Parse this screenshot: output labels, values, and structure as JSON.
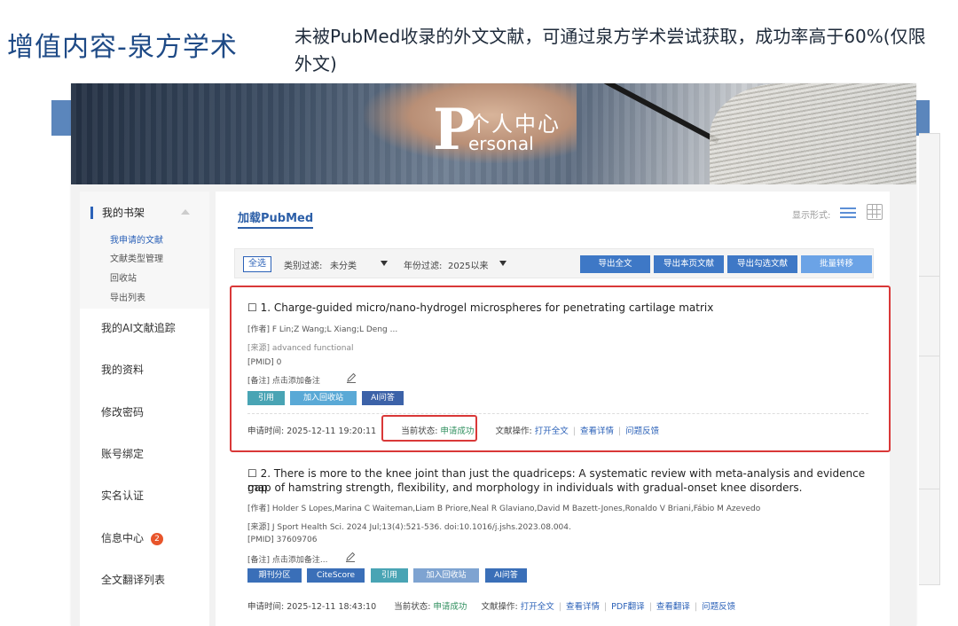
{
  "slide": {
    "title": "增值内容-泉方学术",
    "description": "未被PubMed收录的外文文献，可通过泉方学术尝试获取，成功率高于60%(仅限外文)"
  },
  "banner": {
    "big_letter": "P",
    "title_cn": "个人中心",
    "title_en": "ersonal"
  },
  "sidebar": {
    "group_head": "我的书架",
    "sub_items": [
      "我申请的文献",
      "文献类型管理",
      "回收站",
      "导出列表"
    ],
    "items": [
      "我的AI文献追踪",
      "我的资料",
      "修改密码",
      "账号绑定",
      "实名认证",
      "信息中心",
      "全文翻译列表"
    ],
    "badge_count": "2"
  },
  "main": {
    "title": "加载PubMed",
    "display_label": "显示形式:",
    "filter": {
      "select_all": "全选",
      "category_label": "类别过滤:",
      "category_value": "未分类",
      "year_label": "年份过滤:",
      "year_value": "2025以来",
      "buttons": [
        "导出全文",
        "导出本页文献",
        "导出勾选文献",
        "批量转移"
      ]
    },
    "records": [
      {
        "title": "1. Charge-guided micro/nano-hydrogel microspheres for penetrating cartilage matrix",
        "authors": "[作者] F Lin;Z Wang;L Xiang;L Deng ...",
        "source": "[来源] advanced functional",
        "pmid": "[PMID] 0",
        "note": "[备注] 点击添加备注",
        "chips": [
          "引用",
          "加入回收站",
          "AI问答"
        ],
        "apply_time": "申请时间: 2025-12-11 19:20:11",
        "status_label": "当前状态:",
        "status_value": "申请成功",
        "ops_label": "文献操作:",
        "ops": [
          "打开全文",
          "查看详情",
          "问题反馈"
        ]
      },
      {
        "title_line1": "2. There is more to the knee joint than just the quadriceps: A systematic review with meta-analysis and evidence gap",
        "title_line2": "map of hamstring strength, flexibility, and morphology in individuals with gradual-onset knee disorders.",
        "authors": "[作者] Holder S Lopes,Marina C Waiteman,Liam B Priore,Neal R Glaviano,David M Bazett-Jones,Ronaldo V Briani,Fábio M Azevedo",
        "source": "[来源] J Sport Health Sci. 2024 Jul;13(4):521-536. doi:10.1016/j.jshs.2023.08.004.",
        "pmid": "[PMID] 37609706",
        "note": "[备注] 点击添加备注...",
        "chips": [
          "期刊分区",
          "CiteScore",
          "引用",
          "加入回收站",
          "AI问答"
        ],
        "apply_time": "申请时间: 2025-12-11 18:43:10",
        "status_label": "当前状态:",
        "status_value": "申请成功",
        "ops_label": "文献操作:",
        "ops": [
          "打开全文",
          "查看详情",
          "PDF翻译",
          "查看翻译",
          "问题反馈"
        ]
      }
    ]
  },
  "colors": {
    "accent": "#2c62b8",
    "highlight": "#d93838",
    "success": "#2f8f5e",
    "title": "#1e4a86"
  }
}
